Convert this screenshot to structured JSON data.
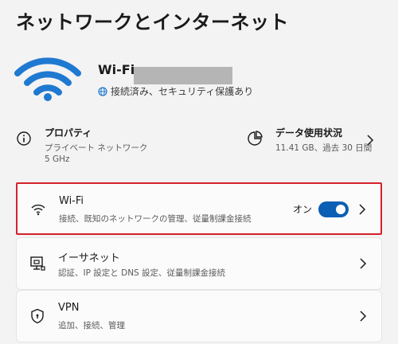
{
  "page": {
    "title": "ネットワークとインターネット"
  },
  "connection": {
    "name": "Wi-Fi",
    "status": "接続済み、セキュリティ保護あり",
    "icon": "wifi-icon",
    "accent_color": "#0067c0"
  },
  "properties": {
    "heading": "プロパティ",
    "line1": "プライベート ネットワーク",
    "line2": "5 GHz",
    "icon": "info-icon"
  },
  "data_usage": {
    "heading": "データ使用状況",
    "line1": "11.41 GB、過去 30 日間",
    "icon": "pie-chart-icon"
  },
  "cards": {
    "wifi": {
      "title": "Wi-Fi",
      "subtitle": "接続、既知のネットワークの管理、従量制課金接続",
      "toggle_label": "オン",
      "toggle_on": true,
      "icon": "wifi-icon",
      "highlight_color": "#d5212b"
    },
    "ethernet": {
      "title": "イーサネット",
      "subtitle": "認証、IP 設定と DNS 設定、従量制課金接続",
      "icon": "ethernet-icon"
    },
    "vpn": {
      "title": "VPN",
      "subtitle": "追加、接続、管理",
      "icon": "shield-icon"
    }
  }
}
